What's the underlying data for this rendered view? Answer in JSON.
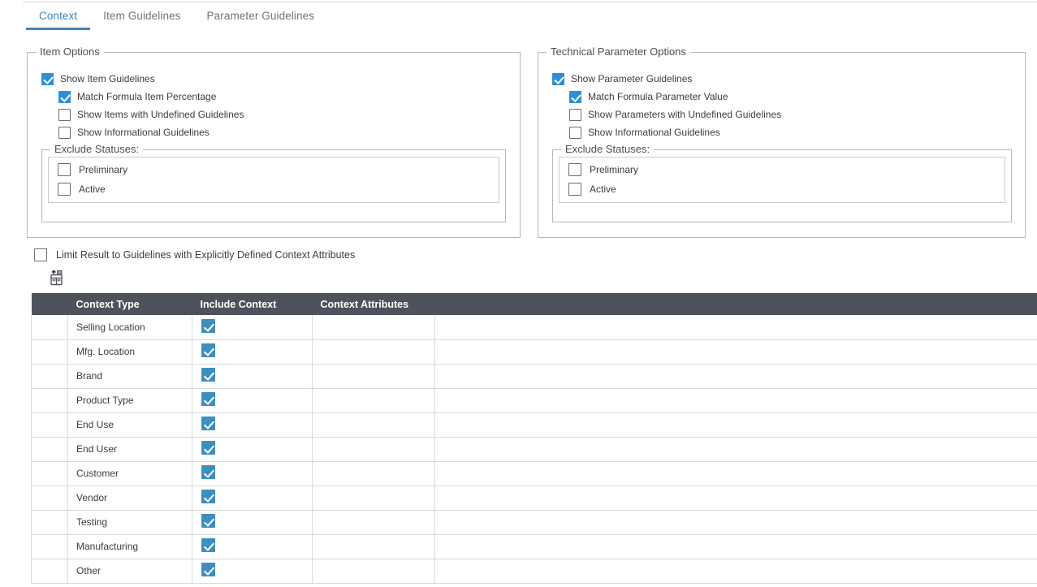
{
  "tabs": [
    {
      "label": "Context",
      "active": true
    },
    {
      "label": "Item Guidelines",
      "active": false
    },
    {
      "label": "Parameter Guidelines",
      "active": false
    }
  ],
  "item_options": {
    "legend": "Item Options",
    "options": [
      {
        "label": "Show Item Guidelines",
        "checked": true,
        "indent": false
      },
      {
        "label": "Match Formula Item Percentage",
        "checked": true,
        "indent": true
      },
      {
        "label": "Show Items with Undefined Guidelines",
        "checked": false,
        "indent": true
      },
      {
        "label": "Show Informational Guidelines",
        "checked": false,
        "indent": true
      }
    ],
    "exclude": {
      "legend": "Exclude Statuses:",
      "statuses": [
        {
          "label": "Preliminary",
          "checked": false
        },
        {
          "label": "Active",
          "checked": false
        }
      ]
    }
  },
  "parameter_options": {
    "legend": "Technical Parameter Options",
    "options": [
      {
        "label": "Show Parameter Guidelines",
        "checked": true,
        "indent": false
      },
      {
        "label": "Match Formula Parameter Value",
        "checked": true,
        "indent": true
      },
      {
        "label": "Show Parameters with Undefined Guidelines",
        "checked": false,
        "indent": true
      },
      {
        "label": "Show Informational Guidelines",
        "checked": false,
        "indent": true
      }
    ],
    "exclude": {
      "legend": "Exclude Statuses:",
      "statuses": [
        {
          "label": "Preliminary",
          "checked": false
        },
        {
          "label": "Active",
          "checked": false
        }
      ]
    }
  },
  "limit_result": {
    "label": "Limit Result to Guidelines with Explicitly Defined Context Attributes",
    "checked": false
  },
  "toolbar": {
    "export_icon": "export-to-spreadsheet-icon"
  },
  "table": {
    "columns": [
      "",
      "Context Type",
      "Include Context",
      "Context Attributes",
      ""
    ],
    "rows": [
      {
        "context_type": "Selling Location",
        "include_context": true,
        "context_attributes": ""
      },
      {
        "context_type": "Mfg. Location",
        "include_context": true,
        "context_attributes": ""
      },
      {
        "context_type": "Brand",
        "include_context": true,
        "context_attributes": ""
      },
      {
        "context_type": "Product Type",
        "include_context": true,
        "context_attributes": ""
      },
      {
        "context_type": "End Use",
        "include_context": true,
        "context_attributes": ""
      },
      {
        "context_type": "End User",
        "include_context": true,
        "context_attributes": ""
      },
      {
        "context_type": "Customer",
        "include_context": true,
        "context_attributes": ""
      },
      {
        "context_type": "Vendor",
        "include_context": true,
        "context_attributes": ""
      },
      {
        "context_type": "Testing",
        "include_context": true,
        "context_attributes": ""
      },
      {
        "context_type": "Manufacturing",
        "include_context": true,
        "context_attributes": ""
      },
      {
        "context_type": "Other",
        "include_context": true,
        "context_attributes": ""
      }
    ]
  },
  "colors": {
    "accent": "#3f86c2",
    "checkbox_blue": "#2f8ed6",
    "table_checkbox_blue": "#3e8ec0",
    "table_header_bg": "#4e525b",
    "border": "#b4b8bc",
    "text": "#3c3c3c"
  }
}
